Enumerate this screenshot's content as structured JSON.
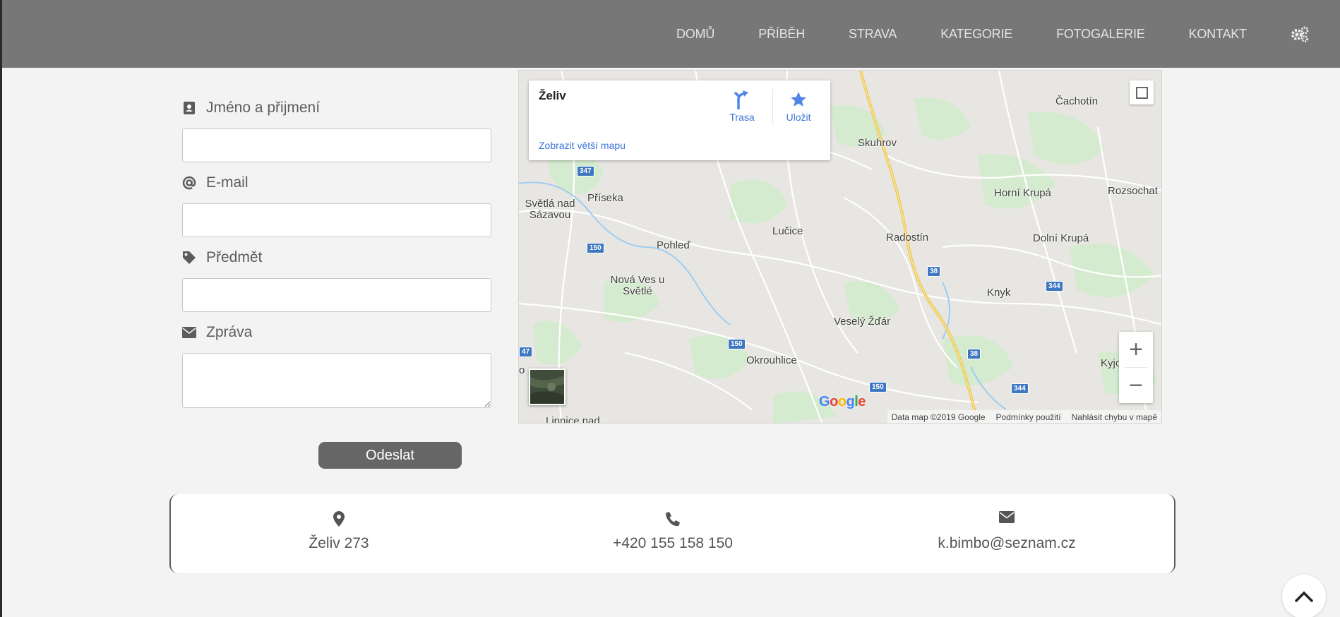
{
  "nav": {
    "items": [
      "DOMŮ",
      "PŘÍBĚH",
      "STRAVA",
      "KATEGORIE",
      "FOTOGALERIE",
      "KONTAKT"
    ]
  },
  "form": {
    "name_label": "Jméno a přijmení",
    "email_label": "E-mail",
    "subject_label": "Předmět",
    "message_label": "Zpráva",
    "name_value": "",
    "email_value": "",
    "subject_value": "",
    "message_value": "",
    "submit_label": "Odeslat"
  },
  "map": {
    "place_title": "Želiv",
    "route_label": "Trasa",
    "save_label": "Uložit",
    "larger_map_link": "Zobrazit větší mapu",
    "zoom_in": "+",
    "zoom_out": "−",
    "logo": "Google",
    "footer": {
      "data": "Data map ©2019 Google",
      "terms": "Podmínky použití",
      "report": "Nahlásit chybu v mapě"
    },
    "places": {
      "cachotin": "Čachotín",
      "skuhrov": "Skuhrov",
      "priseka": "Příseka",
      "svetla": "Světlá nad Sázavou",
      "horni_krupa": "Horní Krupá",
      "rozsochat": "Rozsochat",
      "lucice": "Lučice",
      "radostin": "Radostín",
      "dolni_krupa": "Dolní Krupá",
      "pohled": "Pohleď",
      "nova_ves": "Nová Ves u Světlé",
      "knyk": "Knyk",
      "vesely_zdar": "Veselý Žďár",
      "okrouhlice": "Okrouhlice",
      "kyjov": "Kyjov",
      "lipnice": "Lipnice nad",
      "left_edge_o": "o"
    },
    "roads": {
      "r347": "347",
      "r150a": "150",
      "r38a": "38",
      "r344a": "344",
      "r47": "47",
      "r150b": "150",
      "r38b": "38",
      "r150c": "150",
      "r344b": "344"
    },
    "colors": {
      "link": "#3a74d8",
      "road_badge": "#3e77c2",
      "highway": "#f2cf5a"
    }
  },
  "contact": {
    "address": "Želiv 273",
    "phone": "+420 155 158 150",
    "email": "k.bimbo@seznam.cz"
  },
  "colors": {
    "header": "#777777",
    "button": "#666666",
    "background": "#f3f3f3"
  }
}
